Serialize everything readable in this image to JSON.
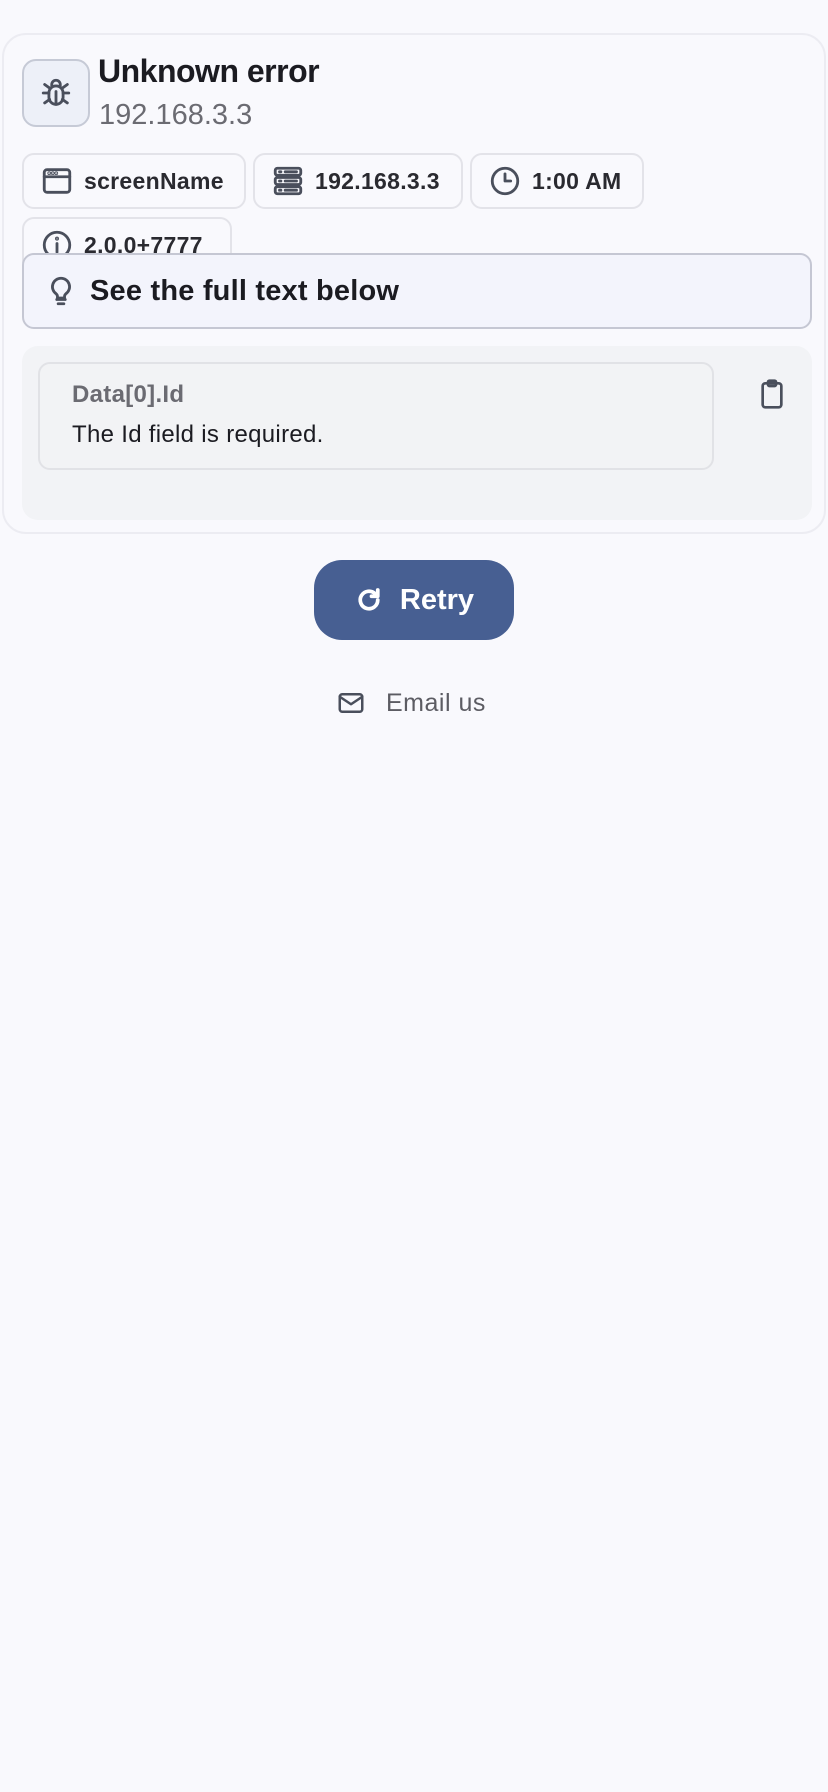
{
  "error": {
    "title": "Unknown error",
    "subtitle": "192.168.3.3",
    "icon": "bug-icon"
  },
  "chips": [
    {
      "icon": "window-icon",
      "label": "screenName"
    },
    {
      "icon": "server-icon",
      "label": "192.168.3.3"
    },
    {
      "icon": "clock-icon",
      "label": "1:00 AM"
    },
    {
      "icon": "info-icon",
      "label": "2.0.0+7777"
    }
  ],
  "hint": {
    "icon": "lightbulb-icon",
    "text": "See the full text below"
  },
  "details": [
    {
      "field": "Data[0].Id",
      "message": "The Id field is required."
    }
  ],
  "actions": {
    "retry_label": "Retry",
    "email_label": "Email us"
  },
  "colors": {
    "background": "#f9f9fd",
    "primary": "#475f92",
    "muted_text": "#6b6b72"
  }
}
